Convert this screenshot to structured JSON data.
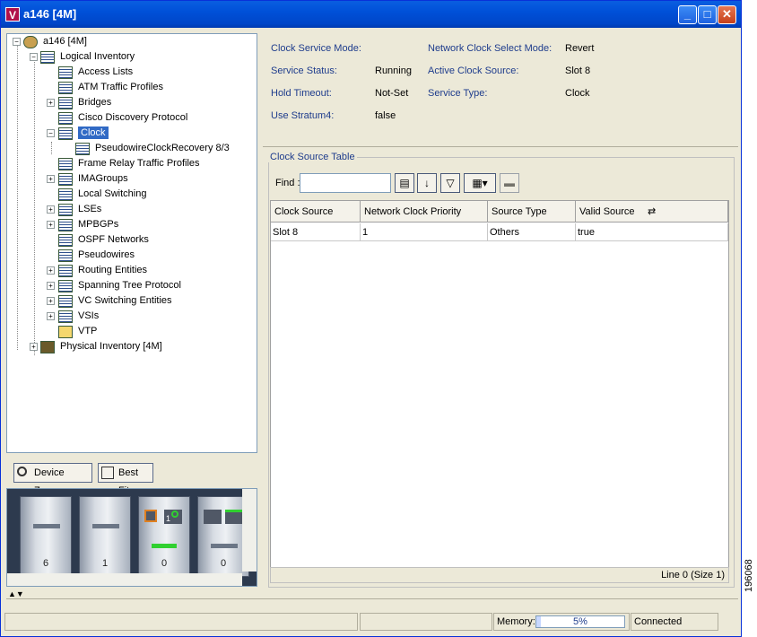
{
  "window": {
    "title": "a146 [4M]",
    "app_icon": "V"
  },
  "tree": {
    "root": "a146 [4M]",
    "logical": "Logical Inventory",
    "items": [
      "Access Lists",
      "ATM Traffic Profiles",
      "Bridges",
      "Cisco Discovery Protocol",
      "Clock",
      "Frame Relay Traffic Profiles",
      "IMAGroups",
      "Local Switching",
      "LSEs",
      "MPBGPs",
      "OSPF Networks",
      "Pseudowires",
      "Routing Entities",
      "Spanning Tree Protocol",
      "VC Switching Entities",
      "VSIs",
      "VTP"
    ],
    "clock_child": "PseudowireClockRecovery 8/3",
    "physical": "Physical Inventory [4M]"
  },
  "zoom": {
    "device_zoom": "Device Zoom",
    "best_fit": "Best Fit"
  },
  "device": {
    "slots": [
      "6",
      "1",
      "0",
      "0"
    ],
    "port_badge": "1"
  },
  "info": {
    "clock_service_mode_label": "Clock Service Mode:",
    "clock_service_mode": "",
    "service_status_label": "Service Status:",
    "service_status": "Running",
    "hold_timeout_label": "Hold Timeout:",
    "hold_timeout": "Not-Set",
    "use_stratum4_label": "Use Stratum4:",
    "use_stratum4": "false",
    "network_clock_select_mode_label": "Network Clock Select Mode:",
    "network_clock_select_mode": "Revert",
    "active_clock_source_label": "Active Clock Source:",
    "active_clock_source": "Slot 8",
    "service_type_label": "Service Type:",
    "service_type": "Clock"
  },
  "table": {
    "legend": "Clock Source Table",
    "find_label": "Find :",
    "find_value": "",
    "headers": [
      "Clock Source",
      "Network Clock Priority",
      "Source Type",
      "Valid Source"
    ],
    "rows": [
      [
        "Slot 8",
        "1",
        "Others",
        "true"
      ]
    ],
    "footer": "Line 0 (Size 1)"
  },
  "status": {
    "memory_label": "Memory:",
    "memory_value": "5%",
    "memory_fraction": 0.05,
    "connection": "Connected"
  },
  "watermark": "196068",
  "colors": {
    "title_bar": "#0050d8",
    "selection": "#316ac5",
    "label_blue": "#1e3c8c"
  }
}
